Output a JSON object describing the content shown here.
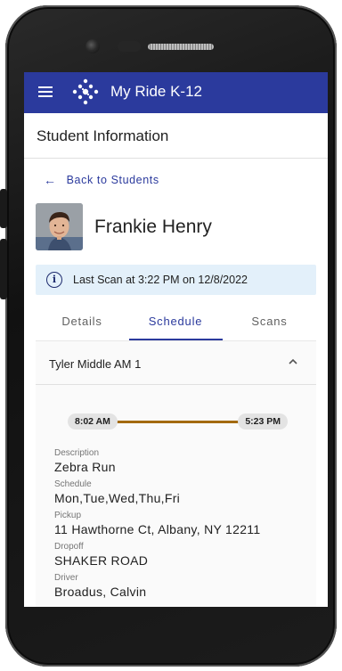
{
  "app": {
    "title": "My Ride K-12"
  },
  "page": {
    "section_title": "Student Information",
    "back_label": "Back to Students"
  },
  "student": {
    "name": "Frankie Henry"
  },
  "scan_banner": {
    "text": "Last Scan at 3:22 PM on 12/8/2022"
  },
  "tabs": [
    {
      "label": "Details",
      "active": false
    },
    {
      "label": "Schedule",
      "active": true
    },
    {
      "label": "Scans",
      "active": false
    }
  ],
  "schedule": {
    "route_name": "Tyler Middle AM 1",
    "start_time": "8:02 AM",
    "end_time": "5:23 PM",
    "fields": [
      {
        "label": "Description",
        "value": "Zebra Run"
      },
      {
        "label": "Schedule",
        "value": "Mon,Tue,Wed,Thu,Fri"
      },
      {
        "label": "Pickup",
        "value": "11 Hawthorne Ct, Albany, NY 12211"
      },
      {
        "label": "Dropoff",
        "value": "SHAKER ROAD"
      },
      {
        "label": "Driver",
        "value": "Broadus, Calvin"
      }
    ]
  },
  "colors": {
    "primary": "#2b3a9d",
    "timeline": "#a36a10",
    "banner": "#e3f0fa"
  },
  "icons": {
    "menu": "hamburger-icon",
    "logo": "diamond-dots-logo",
    "back": "arrow-left-icon",
    "info": "info-circle-icon",
    "collapse": "chevron-up-icon"
  }
}
